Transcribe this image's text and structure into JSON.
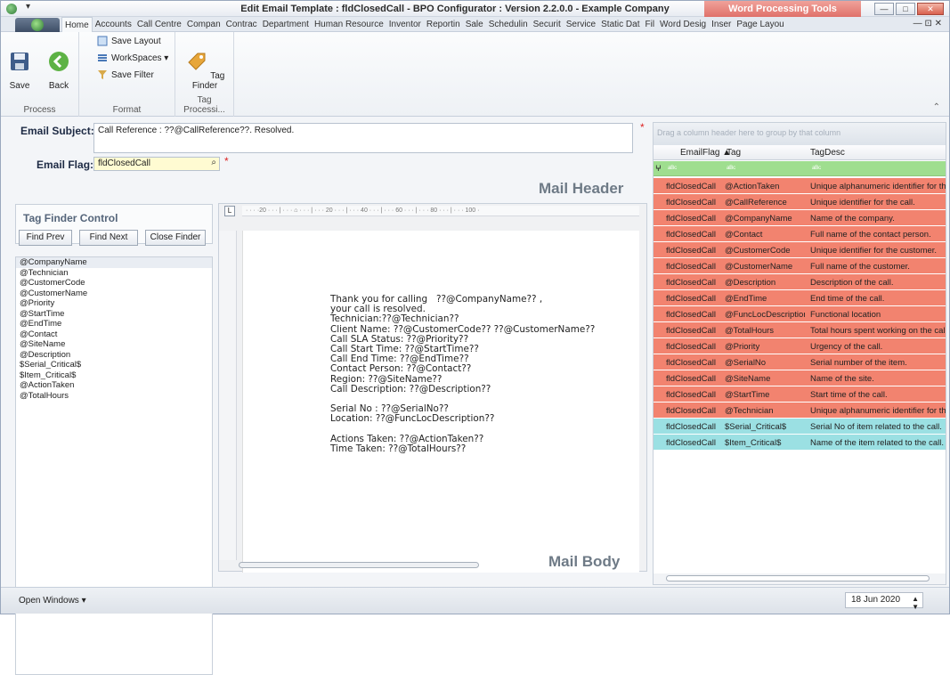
{
  "window": {
    "title": "Edit Email Template : fldClosedCall - BPO Configurator : Version 2.2.0.0 - Example Company",
    "context_tab": "Word Processing Tools",
    "qa_symbol": "▾"
  },
  "tabs": [
    "Home",
    "Accounts",
    "Call Centre",
    "Compan",
    "Contrac",
    "Department",
    "Human Resource",
    "Inventor",
    "Reportin",
    "Sale",
    "Schedulin",
    "Securit",
    "Service",
    "Static Dat",
    "Fil",
    "Word Desig",
    "Inser",
    "Page Layou"
  ],
  "tabs_right": "—  ⊡  ✕",
  "ribbon": {
    "save": "Save",
    "back": "Back",
    "save_layout": "Save Layout",
    "workspaces": "WorkSpaces ▾",
    "save_filter": "Save Filter",
    "tag_finder": "Tag Finder",
    "group_process": "Process",
    "group_format": "Format",
    "group_tag": "Tag Processi..."
  },
  "form": {
    "subject_label": "Email Subject:",
    "subject_value": "Call Reference : ??@CallReference??. Resolved.",
    "flag_label": "Email Flag:",
    "flag_value": "fldClosedCall",
    "mail_header": "Mail Header",
    "mail_body": "Mail Body",
    "required": "*"
  },
  "tag_finder": {
    "title": "Tag Finder Control",
    "find_prev": "Find Prev",
    "find_next": "Find Next",
    "close": "Close Finder",
    "items": [
      "@CompanyName",
      "@Technician",
      "@CustomerCode",
      "@CustomerName",
      "@Priority",
      "@StartTime",
      "@EndTime",
      "@Contact",
      "@SiteName",
      "@Description",
      "$Serial_Critical$",
      "$Item_Critical$",
      "@ActionTaken",
      "@TotalHours"
    ]
  },
  "ruler_text": "· · · ·20 · · · | · · · ⌂ · · · | · · · 20 · · · | · · · 40 · · · | · · · 60 · · · | · · · 80 · · · | · · · 100 ·",
  "email_body": "Thank you for calling   ??@CompanyName?? ,\nyour call is resolved.\nTechnician:??@Technician??\nClient Name: ??@CustomerCode?? ??@CustomerName??\nCall SLA Status: ??@Priority??\nCall Start Time: ??@StartTime??\nCall End Time: ??@EndTime??\nContact Person: ??@Contact??\nRegion: ??@SiteName??\nCall Description: ??@Description??\n\nSerial No : ??@SerialNo??\nLocation: ??@FuncLocDescription??\n\nActions Taken: ??@ActionTaken??\nTime Taken: ??@TotalHours??",
  "grid": {
    "group_hint": "Drag a column header here to group by that column",
    "col_flag": "EmailFlag  ▲",
    "col_tag": "Tag",
    "col_desc": "TagDesc",
    "filter_glyph": "ᵃᴮᶜ",
    "rows": [
      {
        "flag": "fldClosedCall",
        "tag": "@ActionTaken",
        "desc": "Unique alphanumeric identifier for the",
        "color": "red"
      },
      {
        "flag": "fldClosedCall",
        "tag": "@CallReference",
        "desc": "Unique identifier for the call.",
        "color": "red"
      },
      {
        "flag": "fldClosedCall",
        "tag": "@CompanyName",
        "desc": "Name of the company.",
        "color": "red"
      },
      {
        "flag": "fldClosedCall",
        "tag": "@Contact",
        "desc": "Full name of the contact person.",
        "color": "red"
      },
      {
        "flag": "fldClosedCall",
        "tag": "@CustomerCode",
        "desc": "Unique identifier for the customer.",
        "color": "red"
      },
      {
        "flag": "fldClosedCall",
        "tag": "@CustomerName",
        "desc": "Full name of the customer.",
        "color": "red"
      },
      {
        "flag": "fldClosedCall",
        "tag": "@Description",
        "desc": "Description of the call.",
        "color": "red"
      },
      {
        "flag": "fldClosedCall",
        "tag": "@EndTime",
        "desc": "End time of the call.",
        "color": "red"
      },
      {
        "flag": "fldClosedCall",
        "tag": "@FuncLocDescription",
        "desc": "Functional location",
        "color": "red"
      },
      {
        "flag": "fldClosedCall",
        "tag": "@TotalHours",
        "desc": "Total hours spent working on the call",
        "color": "red"
      },
      {
        "flag": "fldClosedCall",
        "tag": "@Priority",
        "desc": "Urgency of the call.",
        "color": "red"
      },
      {
        "flag": "fldClosedCall",
        "tag": "@SerialNo",
        "desc": "Serial number of the item.",
        "color": "red"
      },
      {
        "flag": "fldClosedCall",
        "tag": "@SiteName",
        "desc": "Name of the site.",
        "color": "red"
      },
      {
        "flag": "fldClosedCall",
        "tag": "@StartTime",
        "desc": "Start time of the call.",
        "color": "red"
      },
      {
        "flag": "fldClosedCall",
        "tag": "@Technician",
        "desc": "Unique alphanumeric identifier for the",
        "color": "red"
      },
      {
        "flag": "fldClosedCall",
        "tag": "$Serial_Critical$",
        "desc": "Serial No of item related to the call.",
        "color": "cyan"
      },
      {
        "flag": "fldClosedCall",
        "tag": "$Item_Critical$",
        "desc": "Name of the item related to the call.",
        "color": "cyan"
      }
    ]
  },
  "status": {
    "open_windows": "Open Windows ▾",
    "date": "18 Jun 2020"
  },
  "colors": {
    "row_red": "#f2836f",
    "row_cyan": "#9be0e3",
    "filter_green": "#9fde8f",
    "context_tab": "#e0716a"
  }
}
